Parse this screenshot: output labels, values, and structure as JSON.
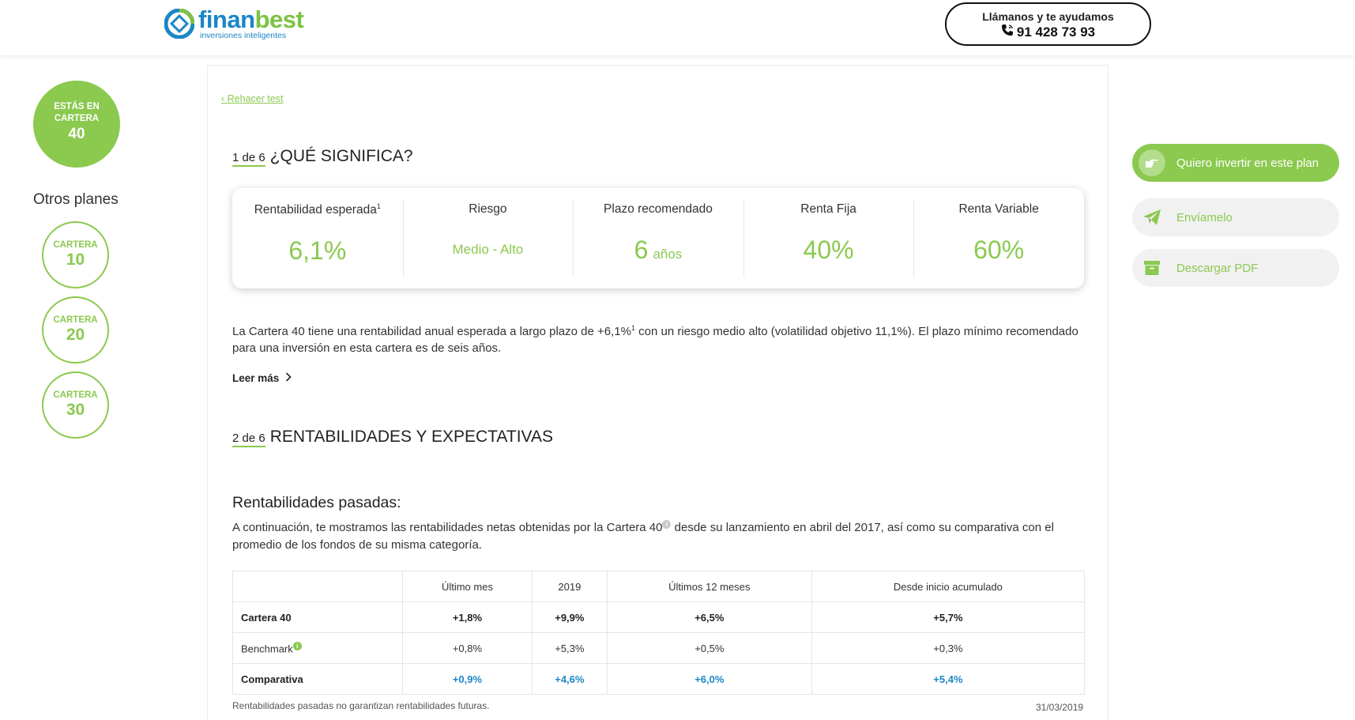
{
  "header": {
    "brand_part1": "finan",
    "brand_part2": "best",
    "tagline": "inversiones inteligentes",
    "call_label": "Llámanos y te ayudamos",
    "phone": "91 428 73 93"
  },
  "sidebar": {
    "current_label": "ESTÁS EN CARTERA",
    "current_number": "40",
    "others_title": "Otros planes",
    "plans": [
      {
        "label": "CARTERA",
        "number": "10"
      },
      {
        "label": "CARTERA",
        "number": "20"
      },
      {
        "label": "CARTERA",
        "number": "30"
      }
    ]
  },
  "main": {
    "rehacer": "‹ Rehacer test",
    "section1": {
      "step": "1 de 6",
      "title": "¿QUÉ SIGNIFICA?"
    },
    "metrics": [
      {
        "label": "Rentabilidad esperada",
        "sup": "1",
        "value": "6,1%",
        "unit": ""
      },
      {
        "label": "Riesgo",
        "sup": "",
        "value": "Medio - Alto",
        "unit": ""
      },
      {
        "label": "Plazo recomendado",
        "sup": "",
        "value": "6",
        "unit": "años"
      },
      {
        "label": "Renta Fija",
        "sup": "",
        "value": "40%",
        "unit": ""
      },
      {
        "label": "Renta Variable",
        "sup": "",
        "value": "60%",
        "unit": ""
      }
    ],
    "description_part1": "La Cartera 40 tiene una rentabilidad anual esperada a largo plazo de +6,1%",
    "description_sup": "1",
    "description_part2": " con un riesgo medio alto (volatilidad objetivo 11,1%). El plazo mínimo recomendado para una inversión en esta cartera es de seis años.",
    "leer_mas": "Leer más",
    "section2": {
      "step": "2 de 6",
      "title": "RENTABILIDADES Y EXPECTATIVAS"
    },
    "past_title": "Rentabilidades pasadas:",
    "past_para_part1": "A continuación, te mostramos las rentabilidades netas obtenidas por la Cartera 40",
    "past_para_part2": " desde su lanzamiento en abril del 2017, así como su comparativa con el promedio de los fondos de su misma categoría.",
    "table": {
      "headers": [
        "",
        "Último mes",
        "2019",
        "Últimos 12 meses",
        "Desde inicio acumulado"
      ],
      "rows": [
        {
          "name": "Cartera 40",
          "values": [
            "+1,8%",
            "+9,9%",
            "+6,5%",
            "+5,7%"
          ]
        },
        {
          "name": "Benchmark",
          "values": [
            "+0,8%",
            "+5,3%",
            "+0,5%",
            "+0,3%"
          ]
        },
        {
          "name": "Comparativa",
          "values": [
            "+0,9%",
            "+4,6%",
            "+6,0%",
            "+5,4%"
          ]
        }
      ],
      "note": "Rentabilidades pasadas no garantizan rentabilidades futuras.",
      "date": "31/03/2019"
    }
  },
  "actions": {
    "invest": "Quiero invertir en este plan",
    "send": "Envíamelo",
    "pdf": "Descargar PDF"
  },
  "colors": {
    "accent": "#8bc94f",
    "brand_blue": "#1c86c6"
  }
}
